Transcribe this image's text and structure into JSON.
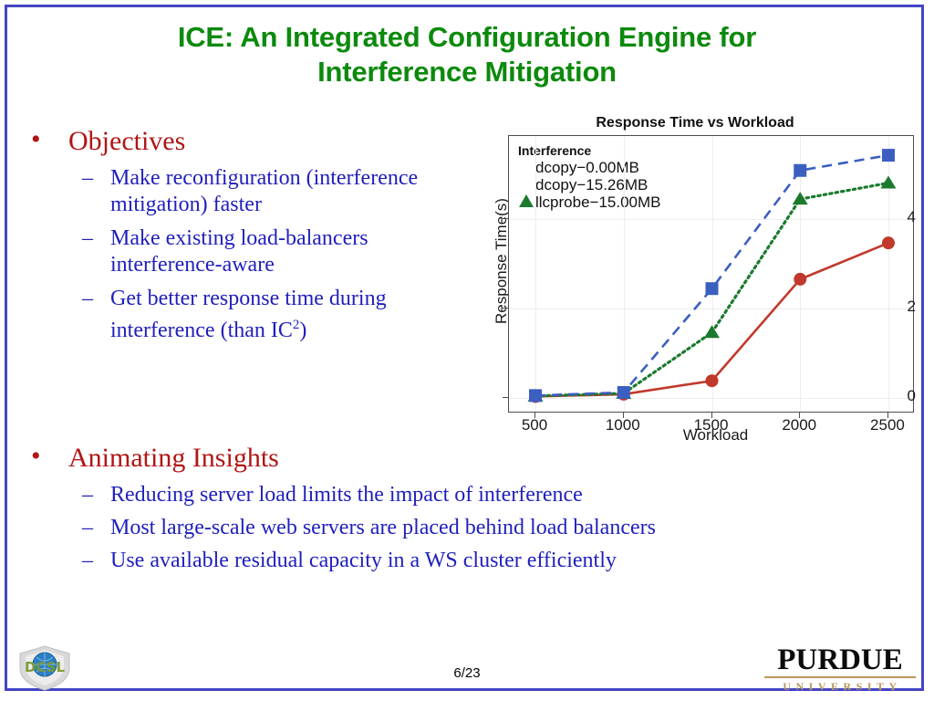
{
  "slide": {
    "title": "ICE: An Integrated Configuration Engine for Interference Mitigation",
    "title_line1": "ICE: An Integrated Configuration Engine for",
    "title_line2": "Interference Mitigation",
    "title_color": "#0c8a0c",
    "border_color": "#4444c4",
    "page_number": "6/23"
  },
  "sections": [
    {
      "heading": "Objectives",
      "heading_color": "#b01515",
      "items": [
        "Make reconfiguration (interference mitigation) faster",
        "Make existing load-balancers interference-aware",
        "Get better response time during interference (than IC2)"
      ],
      "items_html": [
        "Make reconfiguration (interference mitigation) faster",
        "Make existing load-balancers interference-aware",
        "Get better response time during interference (than IC<sup>2</sup>)"
      ]
    },
    {
      "heading": "Animating Insights",
      "heading_color": "#b01515",
      "items": [
        "Reducing server load limits the impact of interference",
        "Most large-scale web servers are placed behind load balancers",
        "Use available residual capacity in a WS cluster efficiently"
      ]
    }
  ],
  "chart_data": {
    "type": "line",
    "title": "Response Time vs Workload",
    "xlabel": "Workload",
    "ylabel": "Response Time(s)",
    "x": [
      500,
      1000,
      1500,
      2000,
      2500
    ],
    "xticks": [
      "500",
      "1000",
      "1500",
      "2000",
      "2500"
    ],
    "yticks": [
      "0",
      "2",
      "4"
    ],
    "ytick_values": [
      0,
      2,
      4
    ],
    "xlim": [
      350,
      2650
    ],
    "ylim": [
      -0.35,
      5.85
    ],
    "grid": true,
    "legend_title": "Interference",
    "legend_position": "top-left inside plot",
    "series": [
      {
        "name": "dcopy-0.00MB",
        "label": "dcopy−0.00MB",
        "color": "#c0392b",
        "marker": "circle",
        "linestyle": "solid",
        "values": [
          0.03,
          0.08,
          0.38,
          2.65,
          3.46
        ]
      },
      {
        "name": "dcopy-15.26MB",
        "label": "dcopy−15.26MB",
        "color": "#1b7a2e",
        "marker": "triangle",
        "linestyle": "dotted",
        "values": [
          0.04,
          0.1,
          1.46,
          4.44,
          4.8
        ]
      },
      {
        "name": "llcprobe-15.00MB",
        "label": "llcprobe−15.00MB",
        "color": "#3b5fc0",
        "marker": "square",
        "linestyle": "dashed",
        "values": [
          0.05,
          0.12,
          2.44,
          5.08,
          5.42
        ]
      }
    ]
  },
  "footer": {
    "dcsl_logo_text": "DCSL",
    "purdue_name": "PURDUE",
    "purdue_sub": "UNIVERSITY"
  }
}
